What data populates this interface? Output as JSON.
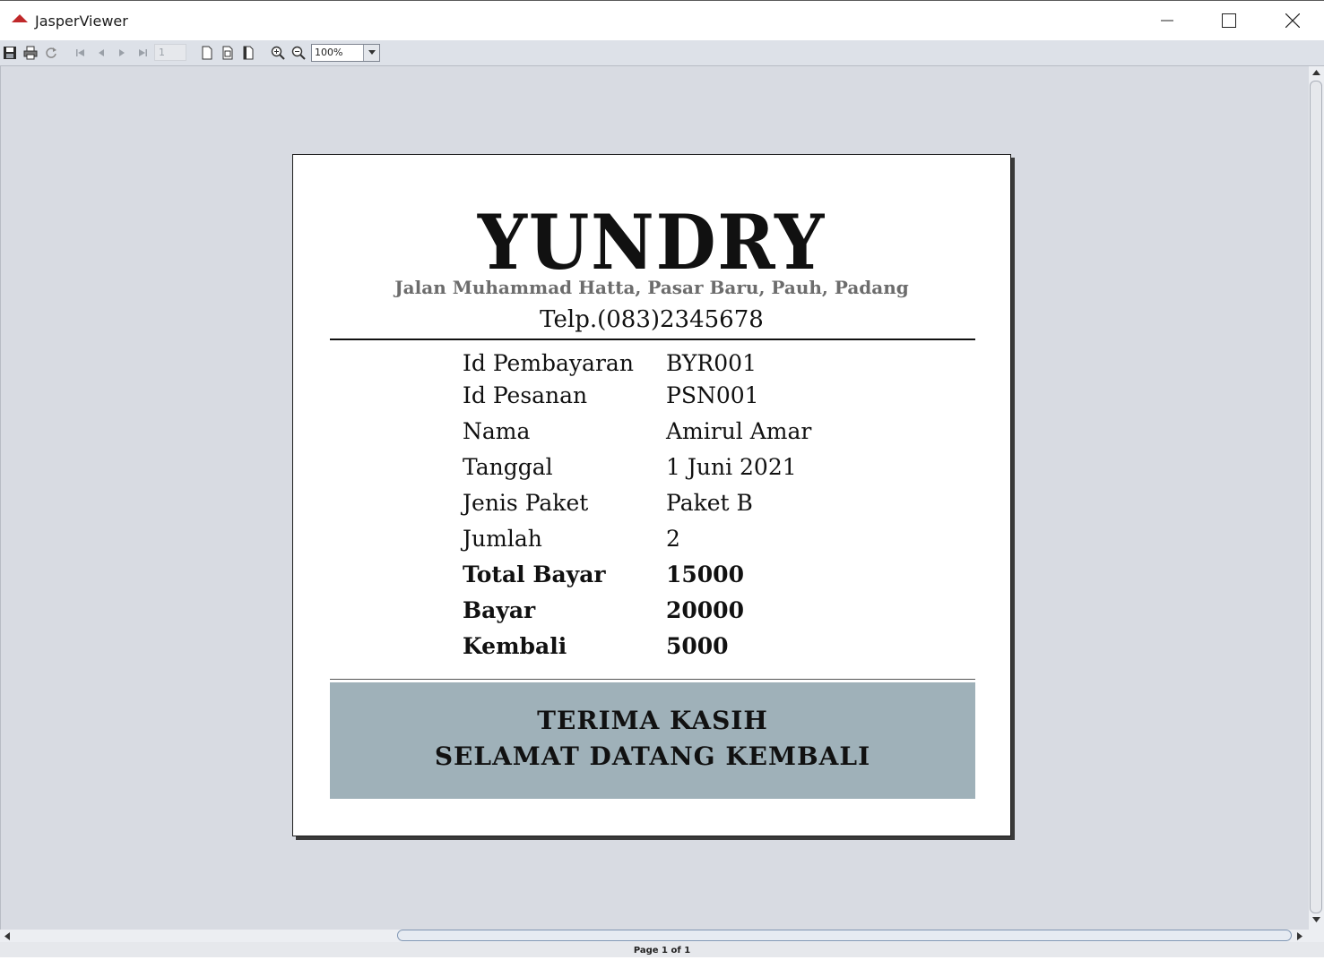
{
  "window": {
    "title": "JasperViewer",
    "icon": "jasper-logo-icon"
  },
  "toolbar": {
    "page_number": "1",
    "zoom_value": "100%"
  },
  "report": {
    "brand": "YUNDRY",
    "address": "Jalan Muhammad Hatta, Pasar Baru, Pauh, Padang",
    "phone": "Telp.(083)2345678",
    "rows": [
      {
        "label": "Id Pembayaran",
        "value": "BYR001"
      },
      {
        "label": "Id Pesanan",
        "value": "PSN001"
      },
      {
        "label": "Nama",
        "value": "Amirul Amar"
      },
      {
        "label": "Tanggal",
        "value": "1 Juni 2021"
      },
      {
        "label": "Jenis Paket",
        "value": "Paket B"
      },
      {
        "label": "Jumlah",
        "value": "2"
      },
      {
        "label": "Total Bayar",
        "value": "15000"
      },
      {
        "label": "Bayar",
        "value": "20000"
      },
      {
        "label": "Kembali",
        "value": "5000"
      }
    ],
    "footer_line1": "TERIMA KASIH",
    "footer_line2": "SELAMAT DATANG KEMBALI",
    "footer_color": "#9fb1b9"
  },
  "status": {
    "page_info": "Page 1 of 1"
  }
}
